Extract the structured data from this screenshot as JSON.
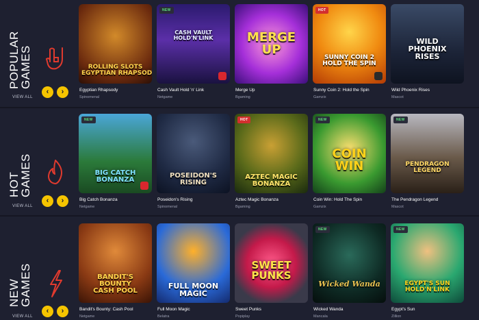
{
  "sections": [
    {
      "title": "POPULAR\nGAMES",
      "view_all": "VIEW ALL",
      "icon": "rock-hand-icon",
      "games": [
        {
          "name": "Egyptian Rhapsody",
          "provider": "Spinomenal",
          "badge": "",
          "logo": "ROLLING SLOTS\nEGYPTIAN RHAPSODY"
        },
        {
          "name": "Cash Vault Hold 'n' Link",
          "provider": "Netgame",
          "badge": "NEW",
          "logo": "CASH VAULT\nHOLD'N'LINK"
        },
        {
          "name": "Merge Up",
          "provider": "Bgaming",
          "badge": "",
          "logo": "MERGE\nUP"
        },
        {
          "name": "Sunny Coin 2: Hold the Spin",
          "provider": "Gamzix",
          "badge": "HOT",
          "logo": "SUNNY COIN 2\nHOLD THE SPIN"
        },
        {
          "name": "Wild Phoenix Rises",
          "provider": "Mascot",
          "badge": "",
          "logo": "WILD\nPHOENIX\nRISES"
        }
      ]
    },
    {
      "title": "HOT\nGAMES",
      "view_all": "VIEW ALL",
      "icon": "flame-icon",
      "games": [
        {
          "name": "Big Catch Bonanza",
          "provider": "Netgame",
          "badge": "NEW",
          "logo": "BIG CATCH\nBONANZA"
        },
        {
          "name": "Poseidon's Rising",
          "provider": "Spinomenal",
          "badge": "",
          "logo": "POSEIDON'S\nRISING"
        },
        {
          "name": "Aztec Magic Bonanza",
          "provider": "Bgaming",
          "badge": "HOT",
          "logo": "AZTEC MAGIC\nBONANZA"
        },
        {
          "name": "Coin Win: Hold The Spin",
          "provider": "Gamzix",
          "badge": "NEW",
          "logo": "COIN\nWIN"
        },
        {
          "name": "The Pendragon Legend",
          "provider": "Mascot",
          "badge": "NEW",
          "logo": "PENDRAGON\nLEGEND"
        }
      ]
    },
    {
      "title": "NEW\nGAMES",
      "view_all": "VIEW ALL",
      "icon": "lightning-icon",
      "games": [
        {
          "name": "Bandit's Bounty: Cash Pool",
          "provider": "Netgame",
          "badge": "",
          "logo": "BANDIT'S\nBOUNTY\nCASH POOL"
        },
        {
          "name": "Full Moon Magic",
          "provider": "Belatra",
          "badge": "",
          "logo": "FULL MOON\nMAGIC"
        },
        {
          "name": "Sweet Punks",
          "provider": "Popiplay",
          "badge": "",
          "logo": "SWEET\nPUNKS"
        },
        {
          "name": "Wicked Wanda",
          "provider": "Mancala",
          "badge": "NEW",
          "logo": "Wicked Wanda"
        },
        {
          "name": "Egypt's Sun",
          "provider": "Zillion",
          "badge": "NEW",
          "logo": "EGYPT'S SUN\nHOLD'N'LINK"
        }
      ]
    }
  ],
  "arrows": {
    "prev": "‹",
    "next": "›"
  },
  "colors": {
    "accent": "#f5c400",
    "icon": "#e03a2e",
    "background": "#1e2030"
  }
}
